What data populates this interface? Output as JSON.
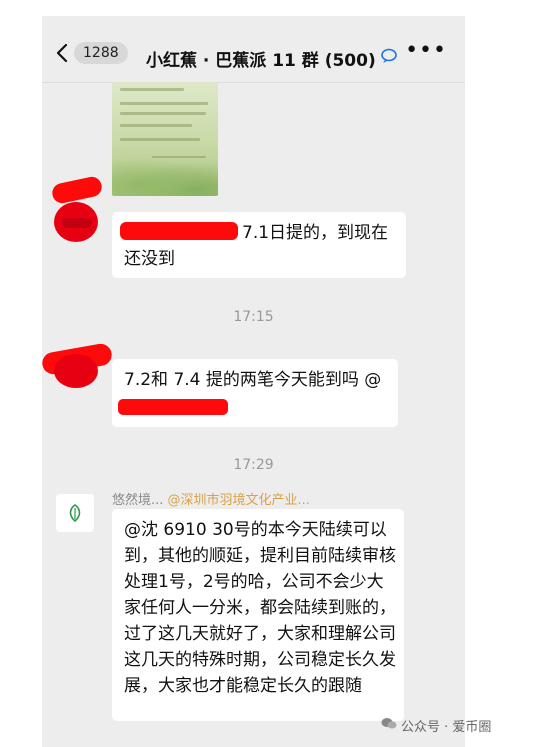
{
  "header": {
    "back_count": "1288",
    "title": "小红蕉 · 巴蕉派 11 群 (500)",
    "more": "•••"
  },
  "messages": [
    {
      "text": "7.1日提的，到现在还没到"
    },
    {
      "text": "7.2和 7.4 提的两笔今天能到吗 @"
    },
    {
      "text": "@沈 6910 30号的本今天陆续可以到，其他的顺延，提利目前陆续审核处理1号，2号的哈，公司不会少大家任何人一分米，都会陆续到账的，过了这几天就好了，大家和理解公司这几天的特殊时期，公司稳定长久发展，大家也才能稳定长久的跟随"
    }
  ],
  "timestamps": [
    "17:15",
    "17:29"
  ],
  "sender": {
    "name": "悠然境...",
    "mention": "@深圳市羽境文化产业..."
  },
  "watermark": {
    "text": "公众号 · 爱币圈"
  },
  "colors": {
    "chat_bg": "#ededed",
    "bubble_bg": "#ffffff",
    "redaction": "#ff0a0a",
    "mention": "#d9a24a"
  }
}
